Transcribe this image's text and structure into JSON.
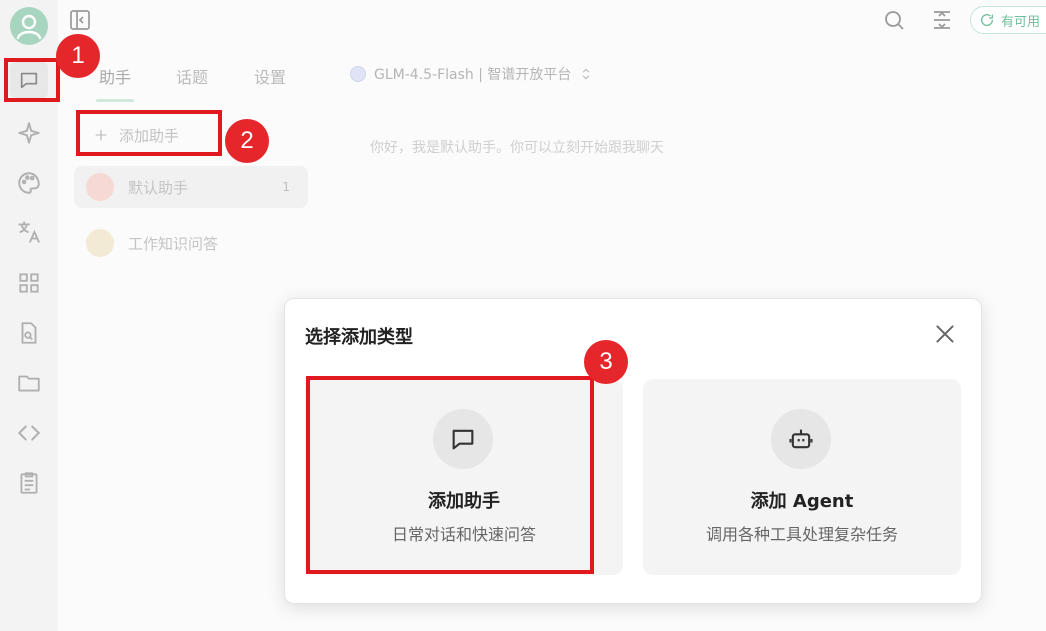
{
  "tabs": [
    {
      "label": "助手",
      "active": true
    },
    {
      "label": "话题",
      "active": false
    },
    {
      "label": "设置",
      "active": false
    }
  ],
  "model_selector": {
    "label": "GLM-4.5-Flash | 智谱开放平台"
  },
  "add_assistant": {
    "label": "添加助手"
  },
  "assistants": [
    {
      "name": "默认助手",
      "count": "1"
    },
    {
      "name": "工作知识问答",
      "count": ""
    }
  ],
  "greeting": "你好，我是默认助手。你可以立刻开始跟我聊天",
  "top_pill": {
    "label": "有可用"
  },
  "badges": [
    "1",
    "2",
    "3"
  ],
  "dialog": {
    "title": "选择添加类型",
    "options": [
      {
        "title": "添加助手",
        "description": "日常对话和快速问答",
        "icon": "chat-bubble-icon"
      },
      {
        "title": "添加 Agent",
        "description": "调用各种工具处理复杂任务",
        "icon": "robot-icon"
      }
    ]
  },
  "colors": {
    "accent": "#6fbf9a",
    "annotation_red": "#e0191e"
  }
}
